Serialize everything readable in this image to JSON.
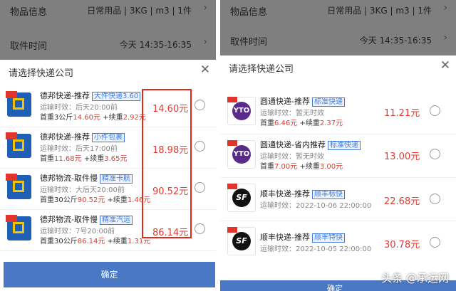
{
  "left": {
    "dim_rows": [
      {
        "label": "物品信息",
        "value": "日常用品 | 3KG | m3 | 1件"
      },
      {
        "label": "取件时间",
        "value": "今天 14:35-16:35"
      }
    ],
    "sheet_title": "请选择快递公司",
    "items": [
      {
        "name": "德邦快递-推荐",
        "tag": "大件快递3.60",
        "eta": "运输时效：后天20:00前",
        "fee_prefix": "首重3公斤",
        "fee_first": "14.60元",
        "fee_mid": " +续重",
        "fee_next": "2.92元",
        "price": "14.60元"
      },
      {
        "name": "德邦快递-推荐",
        "tag": "小件包裹",
        "eta": "运输时效：后天17:00前",
        "fee_prefix": "首重",
        "fee_first": "11.68元",
        "fee_mid": " +续重",
        "fee_next": "3.65元",
        "price": "18.98元"
      },
      {
        "name": "德邦物流-取件慢",
        "tag": "精准卡航",
        "eta": "运输时效：大后天20:00前",
        "fee_prefix": "首重30公斤",
        "fee_first": "90.52元",
        "fee_mid": " +续重",
        "fee_next": "1.46元",
        "price": "90.52元"
      },
      {
        "name": "德邦物流-取件慢",
        "tag": "精准汽运",
        "eta": "运输时效：7号20:00前",
        "fee_prefix": "首重30公斤",
        "fee_first": "86.14元",
        "fee_mid": " +续重",
        "fee_next": "1.31元",
        "price": "86.14元"
      }
    ],
    "confirm_label": "确定"
  },
  "right": {
    "dim_rows": [
      {
        "label": "物品信息",
        "value": "日常用品 | 3KG | m3 | 1件"
      },
      {
        "label": "取件时间",
        "value": "今天 14:35-16:35"
      }
    ],
    "sheet_title": "请选择快递公司",
    "items": [
      {
        "logo": "YTO",
        "name": "圆通快递-推荐",
        "tag": "标准快递",
        "eta": "运输时效：暂无时效",
        "fee_prefix": "首重",
        "fee_first": "6.46元",
        "fee_mid": " +续重",
        "fee_next": "2.37元",
        "price": "11.21元"
      },
      {
        "logo": "YTO",
        "name": "圆通快递-省内推荐",
        "tag": "标准快递",
        "eta": "运输时效：暂无时效",
        "fee_prefix": "首重",
        "fee_first": "7.00元",
        "fee_mid": " +续重",
        "fee_next": "3.00元",
        "price": "13.00元"
      },
      {
        "logo": "SF",
        "name": "顺丰快递-推荐",
        "tag": "顺丰标快",
        "eta": "运输时效：2022-10-06 22:00:00",
        "price": "22.68元"
      },
      {
        "logo": "SF",
        "name": "顺丰快递-推荐",
        "tag": "顺丰特快",
        "eta": "运输时效：2022-10-05 22:00:00",
        "price": "30.78元"
      }
    ],
    "confirm_label": "确定"
  },
  "watermark": "头条 @承运网",
  "colors": {
    "accent": "#4a78c4",
    "price": "#e23b30",
    "tag": "#3d7be0",
    "highlight": "#e8261c"
  }
}
